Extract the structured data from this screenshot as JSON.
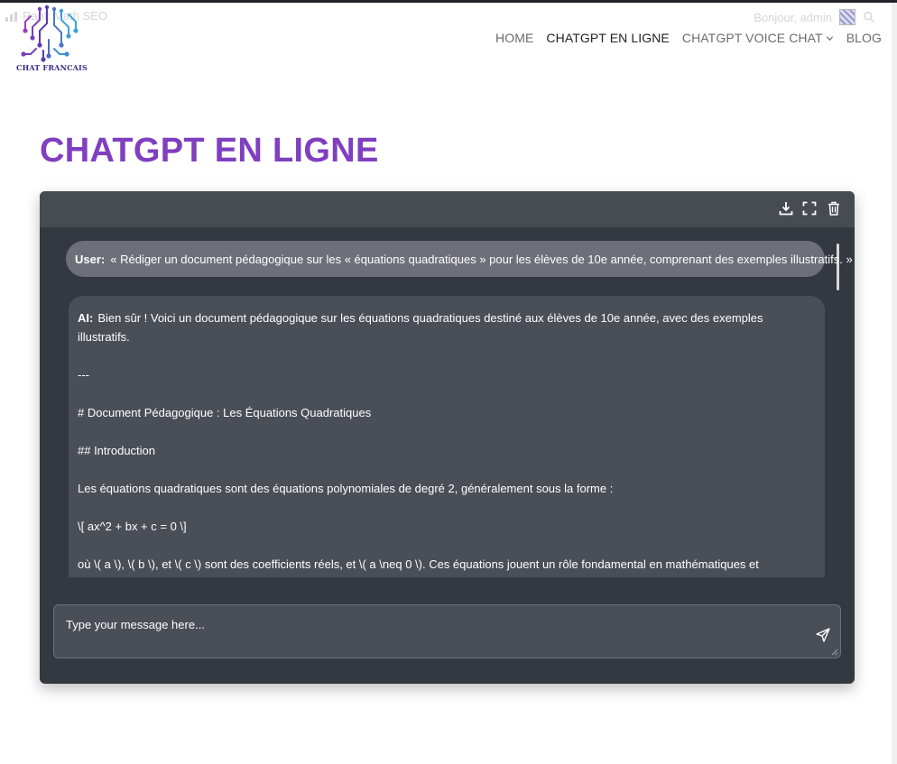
{
  "adminbar": {
    "site_label": "Rank Math SEO",
    "greeting": "Bonjour, admin"
  },
  "logo": {
    "text": "CHAT FRANCAIS"
  },
  "nav": {
    "items": [
      {
        "label": "HOME"
      },
      {
        "label": "CHATGPT EN LIGNE"
      },
      {
        "label": "CHATGPT VOICE CHAT"
      },
      {
        "label": "BLOG"
      }
    ]
  },
  "page": {
    "title": "CHATGPT EN LIGNE"
  },
  "chat": {
    "user_prefix": "User:",
    "user_message": "« Rédiger un document pédagogique sur les « équations quadratiques » pour les élèves de 10e année, comprenant des exemples illustratifs. »",
    "ai_prefix": "AI:",
    "ai_paragraphs": [
      "Bien sûr ! Voici un document pédagogique sur les équations quadratiques destiné aux élèves de 10e année, avec des exemples illustratifs.",
      "---",
      "# Document Pédagogique : Les Équations Quadratiques",
      "## Introduction",
      "Les équations quadratiques sont des équations polynomiales de degré 2, généralement sous la forme :",
      "\\[ ax^2 + bx + c = 0 \\]",
      "où \\( a \\), \\( b \\), et \\( c \\) sont des coefficients réels, et \\( a \\neq 0 \\). Ces équations jouent un rôle fondamental en mathématiques et apparaissent dans divers domaines, tels que la physique, l'économie et l'ingénierie."
    ],
    "input_placeholder": "Type your message here...",
    "colors": {
      "panel": "#343840",
      "toolbar": "#474b52",
      "bubble_user": "#6d7079",
      "bubble_ai": "#4a4e57",
      "title_purple": "#7f3fbf"
    },
    "icons": [
      "download-icon",
      "fullscreen-icon",
      "trash-icon",
      "send-icon"
    ]
  }
}
